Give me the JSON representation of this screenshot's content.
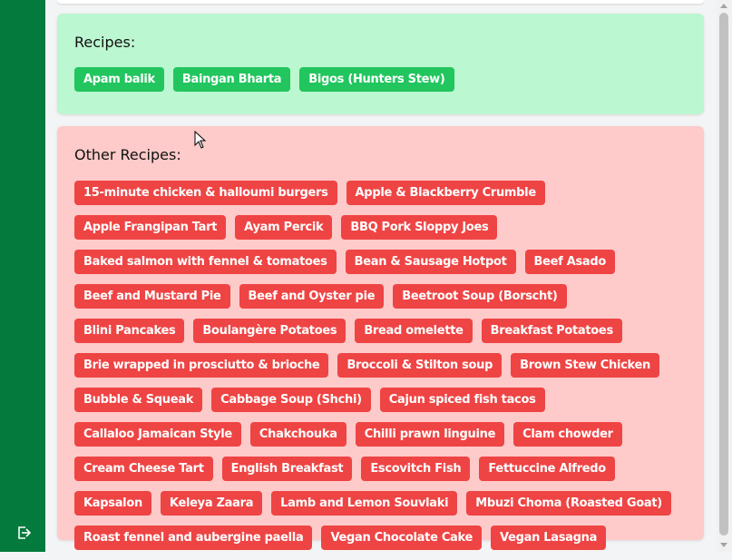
{
  "sidebar": {
    "logout_icon": "logout-icon",
    "bg_color": "#047a3c"
  },
  "recipes_panel": {
    "title": "Recipes:",
    "bg_color": "#bbf7d0",
    "tag_color": "#22c55e",
    "items": [
      "Apam balik",
      "Baingan Bharta",
      "Bigos (Hunters Stew)"
    ]
  },
  "other_recipes_panel": {
    "title": "Other Recipes:",
    "bg_color": "#fecaca",
    "tag_color": "#ef4444",
    "items": [
      "15-minute chicken & halloumi burgers",
      "Apple & Blackberry Crumble",
      "Apple Frangipan Tart",
      "Ayam Percik",
      "BBQ Pork Sloppy Joes",
      "Baked salmon with fennel & tomatoes",
      "Bean & Sausage Hotpot",
      "Beef Asado",
      "Beef and Mustard Pie",
      "Beef and Oyster pie",
      "Beetroot Soup (Borscht)",
      "Blini Pancakes",
      "Boulangère Potatoes",
      "Bread omelette",
      "Breakfast Potatoes",
      "Brie wrapped in prosciutto & brioche",
      "Broccoli & Stilton soup",
      "Brown Stew Chicken",
      "Bubble & Squeak",
      "Cabbage Soup (Shchi)",
      "Cajun spiced fish tacos",
      "Callaloo Jamaican Style",
      "Chakchouka",
      "Chilli prawn linguine",
      "Clam chowder",
      "Cream Cheese Tart",
      "English Breakfast",
      "Escovitch Fish",
      "Fettuccine Alfredo",
      "Kapsalon",
      "Keleya Zaara",
      "Lamb and Lemon Souvlaki",
      "Mbuzi Choma (Roasted Goat)",
      "Roast fennel and aubergine paella",
      "Vegan Chocolate Cake",
      "Vegan Lasagna"
    ]
  }
}
